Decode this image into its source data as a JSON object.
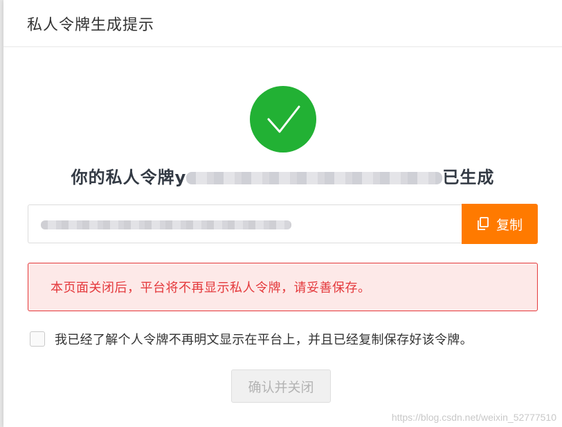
{
  "dialog": {
    "title": "私人令牌生成提示",
    "success_icon": "check-circle-icon",
    "token_message_prefix": "你的私人令牌y",
    "token_message_suffix": "已生成",
    "token_value_redacted": true,
    "copy_icon": "copy-icon",
    "copy_label": "复制",
    "warning_text": "本页面关闭后，平台将不再显示私人令牌，请妥善保存。",
    "confirm_checkbox_label": "我已经了解个人令牌不再明文显示在平台上，并且已经复制保存好该令牌。",
    "confirm_checked": false,
    "confirm_button_label": "确认并关闭",
    "confirm_button_enabled": false
  },
  "colors": {
    "success": "#22b134",
    "accent": "#ff7a00",
    "danger": "#e4383b",
    "danger_bg": "#fde9e8"
  },
  "watermark": "https://blog.csdn.net/weixin_52777510"
}
